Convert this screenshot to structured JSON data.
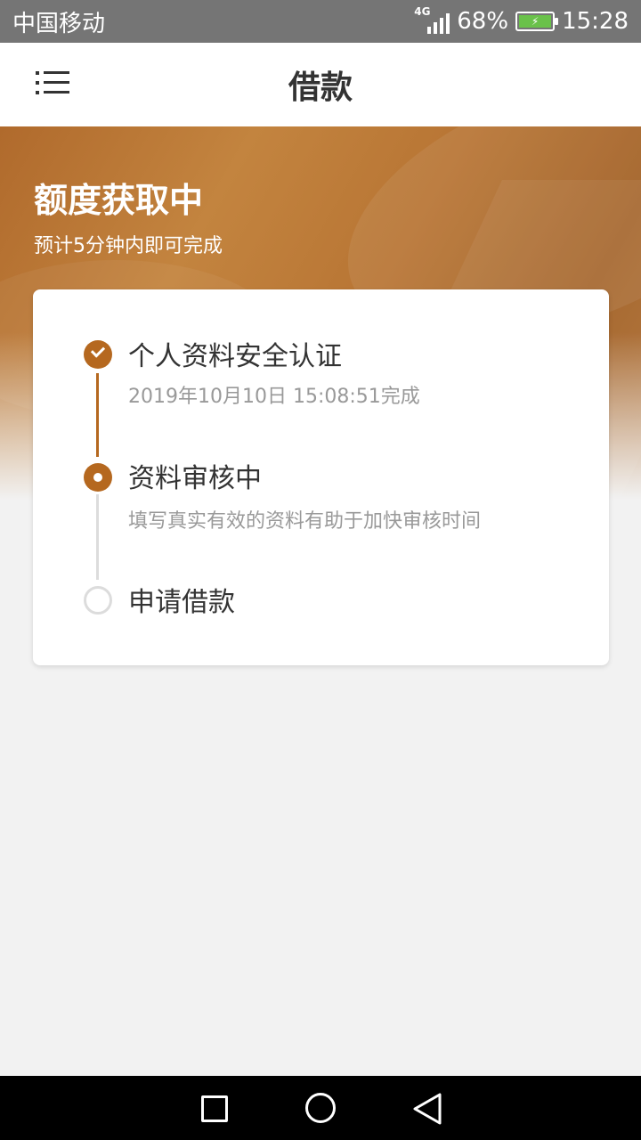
{
  "status_bar": {
    "carrier": "中国移动",
    "network": "4G",
    "battery_percent": "68%",
    "time": "15:28"
  },
  "app_bar": {
    "title": "借款",
    "menu_icon": "menu-icon"
  },
  "hero": {
    "title": "额度获取中",
    "subtitle": "预计5分钟内即可完成"
  },
  "steps": [
    {
      "title": "个人资料安全认证",
      "desc": "2019年10月10日 15:08:51完成",
      "state": "done"
    },
    {
      "title": "资料审核中",
      "desc": "填写真实有效的资料有助于加快审核时间",
      "state": "active"
    },
    {
      "title": "申请借款",
      "desc": "",
      "state": "pending"
    }
  ],
  "colors": {
    "accent": "#b5681f",
    "pending": "#dcdcdc",
    "background": "#f2f2f2"
  },
  "nav_bar": {
    "icons": [
      "square-icon",
      "circle-icon",
      "triangle-back-icon"
    ]
  }
}
